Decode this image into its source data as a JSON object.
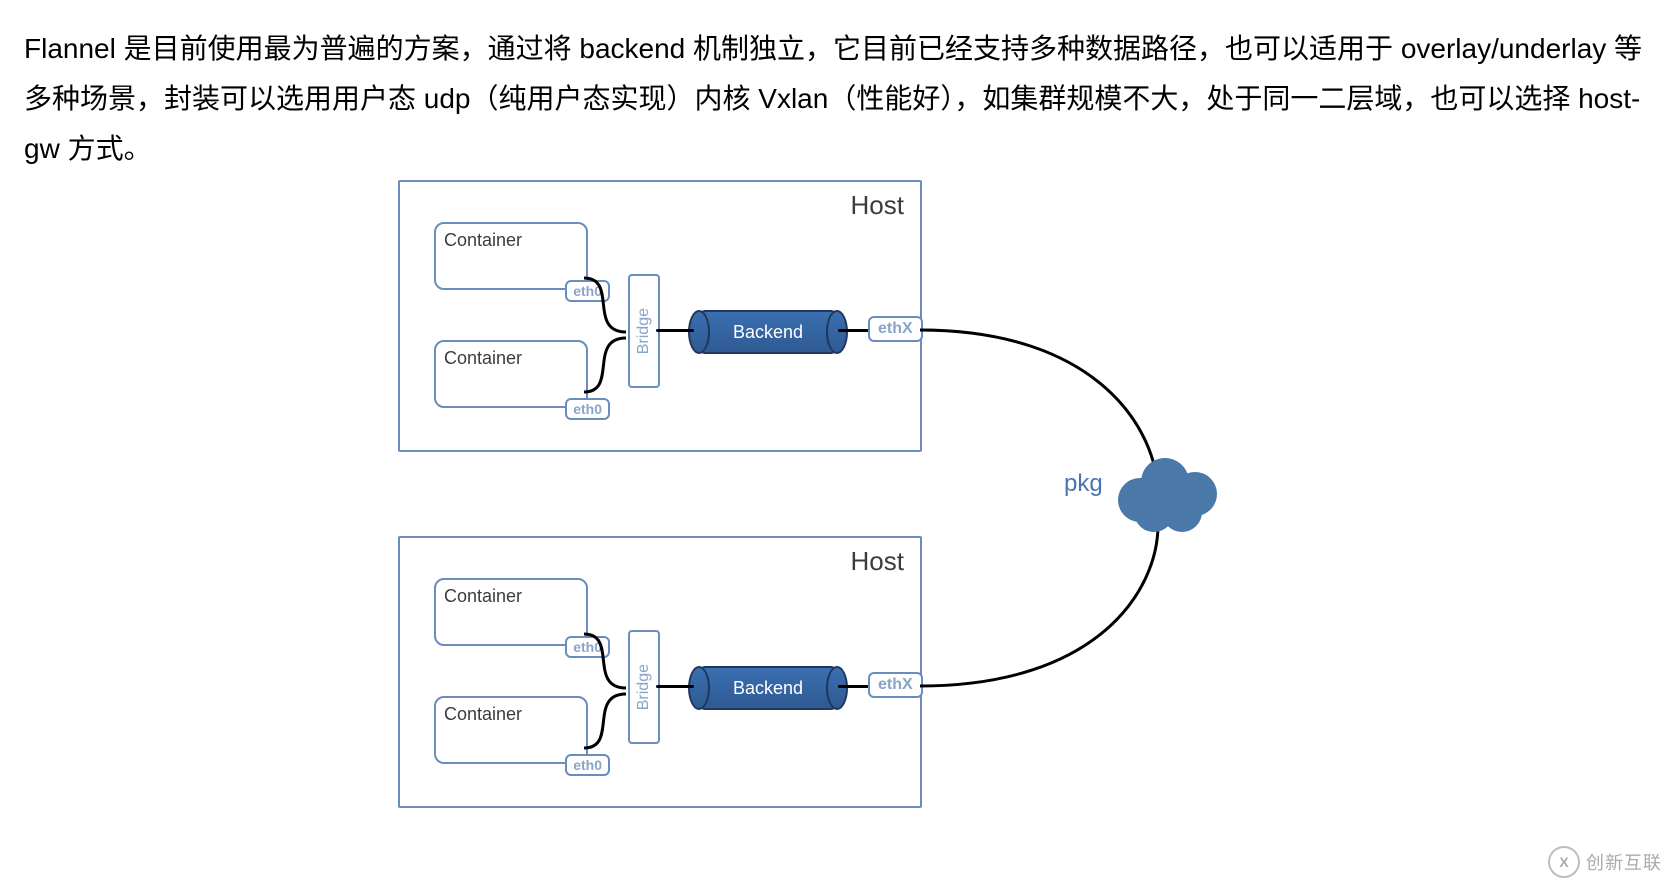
{
  "description": "Flannel 是目前使用最为普遍的方案，通过将 backend 机制独立，它目前已经支持多种数据路径，也可以适用于 overlay/underlay 等多种场景，封装可以选用用户态 udp（纯用户态实现）内核 Vxlan（性能好），如集群规模不大，处于同一二层域，也可以选择 host-gw 方式。",
  "diagram": {
    "host_label": "Host",
    "container_label": "Container",
    "eth0_label": "eth0",
    "bridge_label": "Bridge",
    "backend_label": "Backend",
    "ethx_label": "ethX",
    "pkg_label": "pkg",
    "hosts": [
      {
        "id": "host-top"
      },
      {
        "id": "host-bottom"
      }
    ]
  },
  "watermark": {
    "brand": "创新互联",
    "logo": "X"
  }
}
